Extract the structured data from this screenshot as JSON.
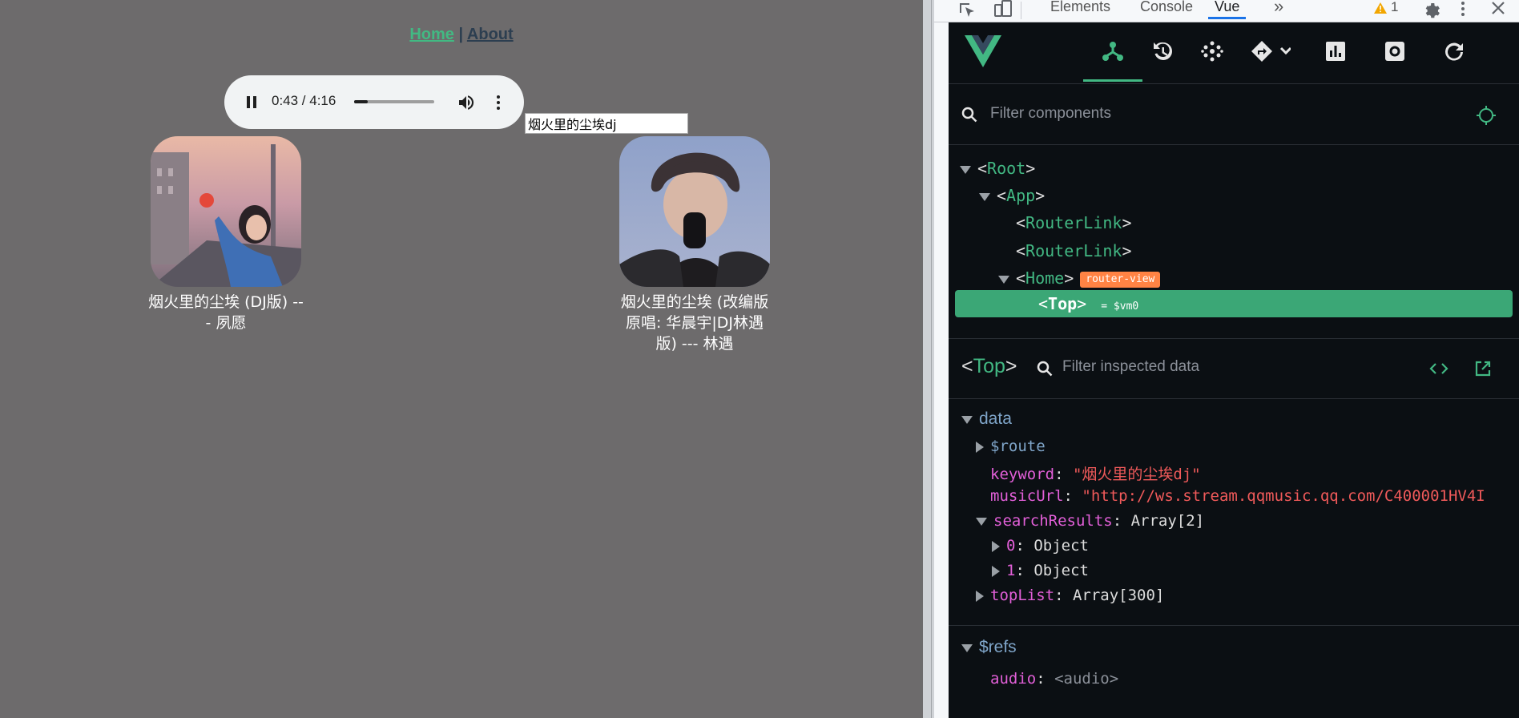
{
  "app": {
    "nav": {
      "home": "Home",
      "separator": "|",
      "about": "About"
    },
    "player": {
      "time": "0:43 / 4:16",
      "progress": 0.168
    },
    "search": {
      "value": "烟火里的尘埃dj"
    },
    "results": [
      {
        "title": "烟火里的尘埃 (DJ版) --- 夙愿"
      },
      {
        "title": "烟火里的尘埃 (改编版 原唱: 华晨宇|DJ林遇 版) --- 林遇"
      }
    ]
  },
  "devtools": {
    "tabs": [
      "Elements",
      "Console",
      "Vue"
    ],
    "more": "»",
    "warning_count": "1",
    "filter_placeholder": "Filter components",
    "tree": {
      "root": "Root",
      "app": "App",
      "router_link_1": "RouterLink",
      "router_link_2": "RouterLink",
      "home": "Home",
      "home_badge": "router-view",
      "top": "Top",
      "top_vm": "= $vm0"
    },
    "inspector": {
      "component": "Top",
      "filter_placeholder": "Filter inspected data",
      "data_title": "data",
      "route_key": "$route",
      "keyword_key": "keyword",
      "keyword_value": "\"烟火里的尘埃dj\"",
      "musicUrl_key": "musicUrl",
      "musicUrl_value": "\"http://ws.stream.qqmusic.qq.com/C400001HV4I",
      "searchResults_key": "searchResults",
      "searchResults_value": "Array[2]",
      "item0_key": "0",
      "item0_value": "Object",
      "item1_key": "1",
      "item1_value": "Object",
      "topList_key": "topList",
      "topList_value": "Array[300]",
      "refs_title": "$refs",
      "audio_key": "audio",
      "audio_value": "<audio>"
    }
  },
  "colors": {
    "vue_green": "#42b883",
    "selected_row": "#3ba776",
    "badge": "#ff8344",
    "page_bg": "#6d6b6c",
    "panel_bg": "#0b0f13"
  }
}
